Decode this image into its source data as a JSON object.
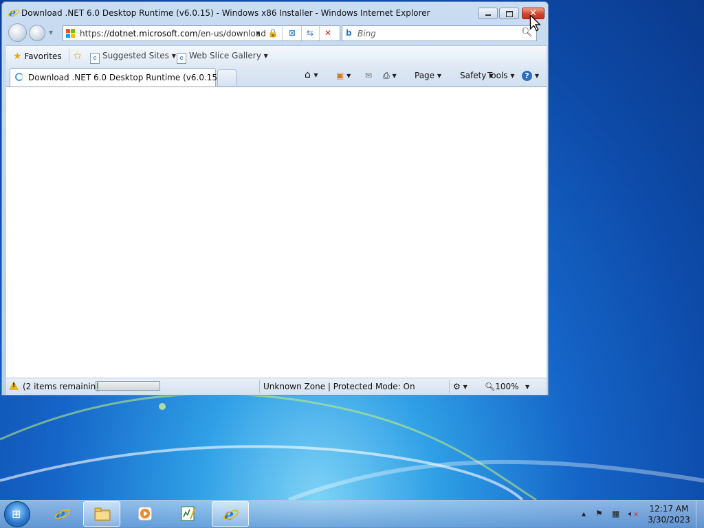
{
  "window": {
    "title": "Download .NET 6.0 Desktop Runtime (v6.0.15) - Windows x86 Installer - Windows Internet Explorer"
  },
  "address": {
    "url_scheme": "https://",
    "url_host": "dotnet.microsoft.com",
    "url_path": "/en-us/download"
  },
  "search": {
    "placeholder": "Bing"
  },
  "favorites_bar": {
    "favorites_label": "Favorites",
    "suggested_sites_label": "Suggested Sites",
    "web_slice_gallery_label": "Web Slice Gallery"
  },
  "tab": {
    "title": "Download .NET 6.0 Desktop Runtime (v6.0.15) - ..."
  },
  "command_bar": {
    "page_label": "Page",
    "safety_label": "Safety",
    "tools_label": "Tools"
  },
  "status_bar": {
    "items_remaining": "(2 items remaining)",
    "progress": 0.02,
    "zone": "Unknown Zone | Protected Mode: On",
    "zoom": "100%"
  },
  "taskbar": {
    "time": "12:17 AM",
    "date": "3/30/2023"
  },
  "colors": {
    "ie_blue": "#1f7ad6",
    "close_red": "#d2452a",
    "progress_green": "#3bb44a",
    "warning_yellow": "#e8b818"
  }
}
